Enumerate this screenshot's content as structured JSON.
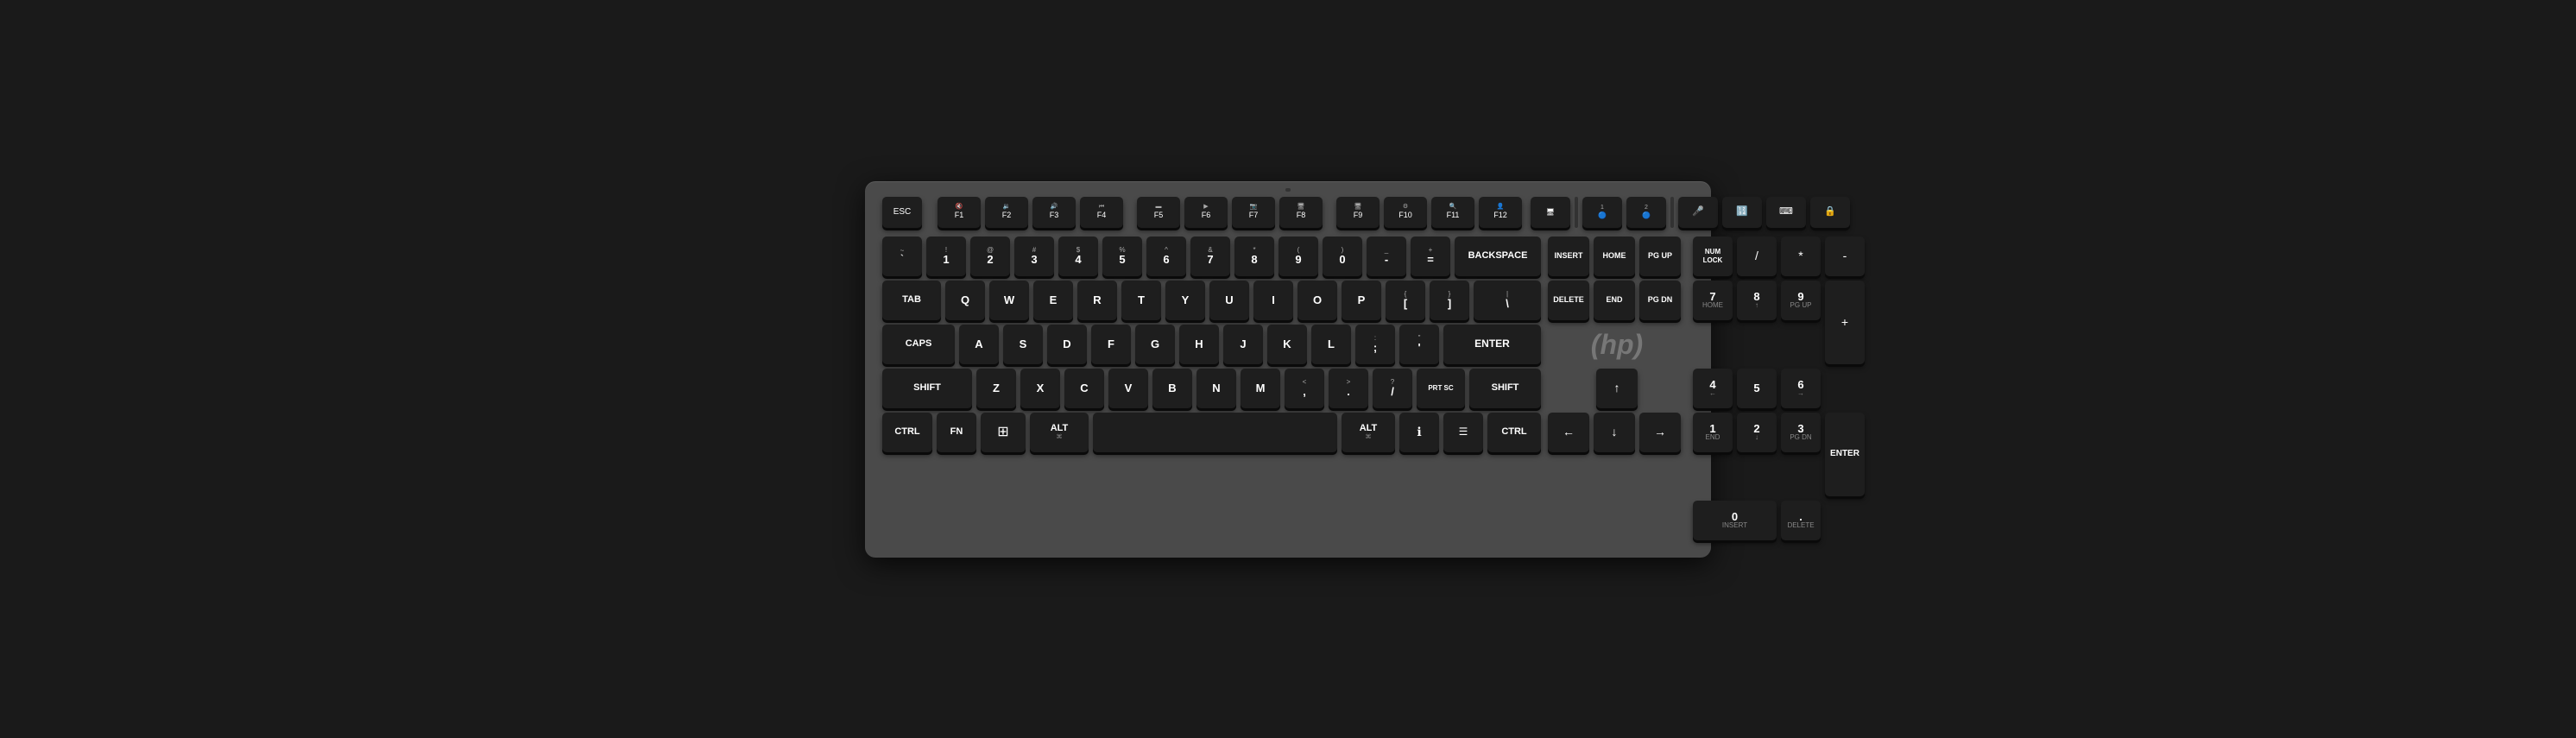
{
  "keyboard": {
    "brand": "HP",
    "color_body": "#4a4a4a",
    "color_key": "#1e1e1e",
    "rows": {
      "fn_row": [
        "ESC",
        "F1",
        "F2",
        "F3",
        "F4",
        "F5",
        "F6",
        "F7",
        "F8",
        "F9",
        "F10",
        "F11",
        "F12"
      ],
      "fn_icons": [
        "",
        "🔇",
        "🔉",
        "🔊",
        "⏮",
        "⬛",
        "▶",
        "📷",
        "📷",
        "⚙",
        "🔍",
        "🔒",
        "👤"
      ],
      "num_row": [
        "~\n`",
        "!\n1",
        "@\n2",
        "#\n3",
        "$\n4",
        "%\n5",
        "^\n6",
        "&\n7",
        "*\n8",
        "(\n9",
        ")\n0",
        "_\n-",
        "+\n=",
        "BACKSPACE"
      ],
      "tab_row": [
        "TAB",
        "Q",
        "W",
        "E",
        "R",
        "T",
        "Y",
        "U",
        "I",
        "O",
        "P",
        "{\n[",
        "}\n]",
        "|\n\\"
      ],
      "caps_row": [
        "CAPS",
        "A",
        "S",
        "D",
        "F",
        "G",
        "H",
        "J",
        "K",
        "L",
        ";\n:",
        "'\n\"",
        "ENTER"
      ],
      "shift_row": [
        "SHIFT",
        "Z",
        "X",
        "C",
        "V",
        "B",
        "N",
        "M",
        "<\n,",
        ">\n.",
        "?\n/",
        "PRT SC",
        "SHIFT"
      ],
      "bottom_row": [
        "CTRL",
        "FN",
        "WIN",
        "ALT",
        "SPACE",
        "ALT",
        "INFO",
        "MENU",
        "CTRL"
      ]
    },
    "right_cluster": {
      "top": [
        "INSERT",
        "HOME",
        "PG UP"
      ],
      "mid": [
        "DELETE",
        "END",
        "PG DN"
      ],
      "arrows": [
        "↑",
        "←",
        "↓",
        "→"
      ]
    },
    "numpad": {
      "top": [
        "NUM LOCK",
        "/",
        "*",
        "-"
      ],
      "row1": [
        "7\nHOME",
        "8\n↑",
        "9\nPG UP",
        "+"
      ],
      "row2": [
        "4\n←",
        "5",
        "6\n→"
      ],
      "row3": [
        "1\nEND",
        "2\n↓",
        "3\nPG DN",
        "ENTER"
      ],
      "row4": [
        "0\nINSERT",
        ".",
        "DELETE"
      ]
    },
    "bluetooth_keys": [
      "BT1",
      "BT2"
    ],
    "media_keys": [
      "🎤",
      "📊",
      "⌨",
      "🔒"
    ]
  }
}
